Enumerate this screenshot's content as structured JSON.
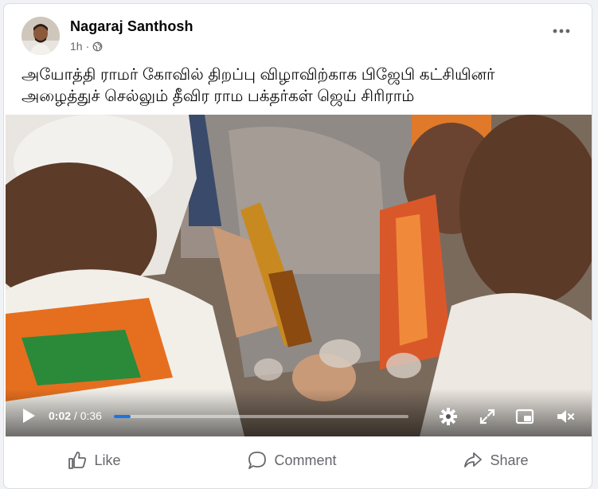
{
  "post": {
    "author": "Nagaraj Santhosh",
    "time": "1h",
    "audience_icon": "globe-icon",
    "more_icon": "more-options-icon",
    "text_line1": "அயோத்தி ராமர் கோவில் திறப்பு விழாவிற்காக பிஜேபி கட்சியினர்",
    "text_line2": "அழைத்துச் செல்லும் தீவிர ராம பக்தர்கள் ஜெய் சிரிராம்"
  },
  "video": {
    "current_time": "0:02",
    "separator": " / ",
    "duration": "0:36",
    "progress_fraction": 0.056,
    "accent_color": "#1b74e4",
    "icons": [
      "play-icon",
      "settings-gear-icon",
      "fullscreen-expand-icon",
      "picture-in-picture-icon",
      "volume-muted-icon"
    ]
  },
  "actions": {
    "like": "Like",
    "comment": "Comment",
    "share": "Share"
  }
}
